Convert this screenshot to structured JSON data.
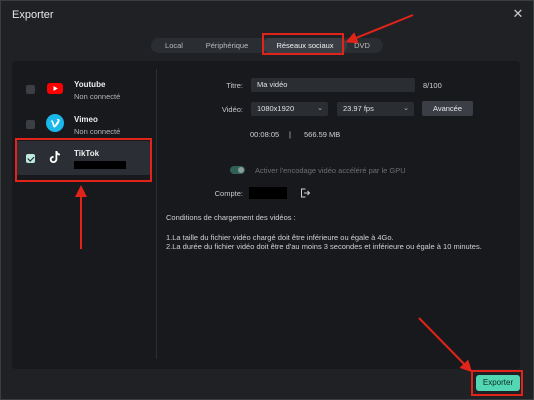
{
  "window": {
    "title": "Exporter"
  },
  "tabs": [
    {
      "label": "Local"
    },
    {
      "label": "Périphérique"
    },
    {
      "label": "Réseaux sociaux",
      "active": true
    },
    {
      "label": "DVD"
    }
  ],
  "accounts": [
    {
      "name": "Youtube",
      "status": "Non connecté",
      "icon": "youtube-icon",
      "checked": false
    },
    {
      "name": "Vimeo",
      "status": "Non connecté",
      "icon": "vimeo-icon",
      "checked": false
    },
    {
      "name": "TikTok",
      "status": "",
      "icon": "tiktok-icon",
      "checked": true,
      "status_redacted": true
    }
  ],
  "form": {
    "title_label": "Titre:",
    "title_value": "Ma vidéo",
    "title_count": "8/100",
    "video_label": "Vidéo:",
    "resolution": "1080x1920",
    "fps": "23.97 fps",
    "advanced_label": "Avancée",
    "duration": "00:08:05",
    "separator": "|",
    "size": "566.59 MB",
    "gpu_label": "Activer l'encodage vidéo accéléré par le GPU",
    "account_label": "Compte:"
  },
  "conditions": {
    "heading": "Conditions de chargement des vidéos :",
    "line1": "1.La taille du fichier vidéo chargé doit être inférieure ou égale à 4Go.",
    "line2": "2.La durée du fichier vidéo doit être d'au moins 3 secondes et inférieure ou égale à 10 minutes."
  },
  "export_label": "Exporter",
  "colors": {
    "accent": "#52d6b4",
    "annotation": "#e2231a",
    "youtube": "#ff0000",
    "vimeo": "#1ab7ea"
  }
}
